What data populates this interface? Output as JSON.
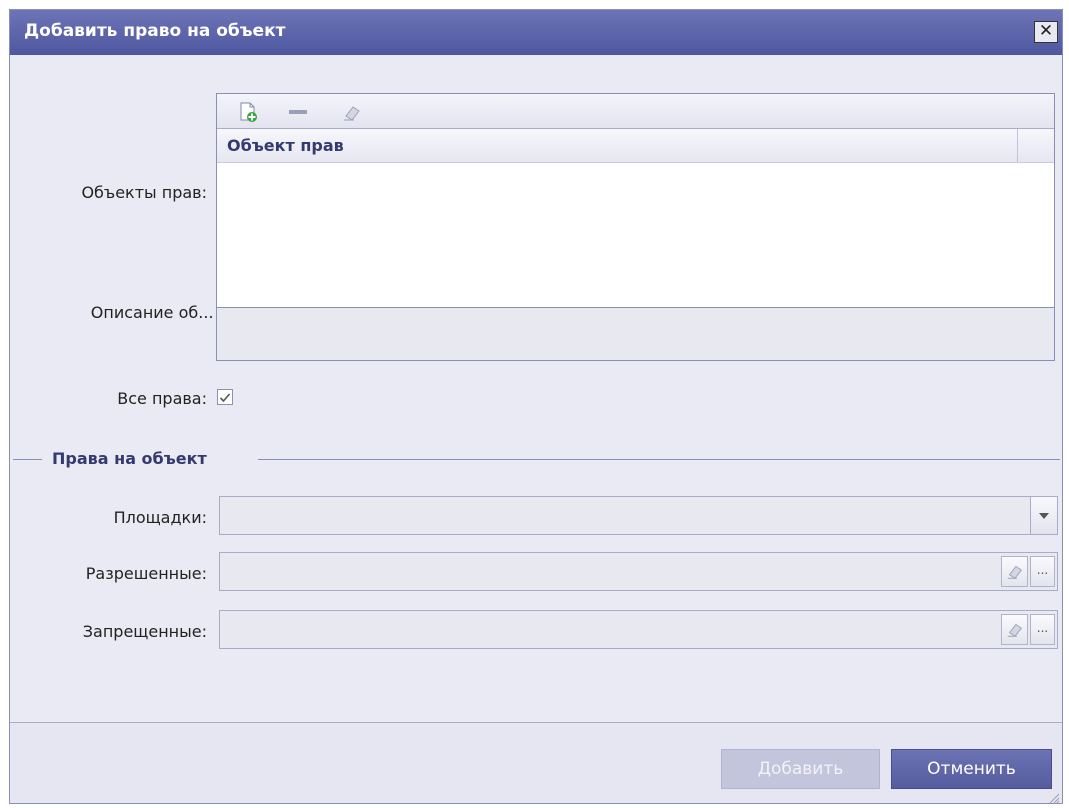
{
  "dialog": {
    "title": "Добавить право на объект",
    "close_label": "✕"
  },
  "form": {
    "objects_label": "Объекты прав:",
    "description_label": "Описание об... :",
    "all_rights_label": "Все права:",
    "all_rights_checked": true
  },
  "grid": {
    "toolbar": [
      {
        "name": "add-row-icon"
      },
      {
        "name": "remove-row-icon"
      },
      {
        "name": "clear-eraser-icon"
      }
    ],
    "columns": [
      "Объект прав"
    ],
    "rows": []
  },
  "fieldset": {
    "legend": "Права на объект",
    "sites_label": "Площадки:",
    "allowed_label": "Разрешенные:",
    "denied_label": "Запрещенные:",
    "ellipsis_label": "..."
  },
  "footer": {
    "add_label": "Добавить",
    "cancel_label": "Отменить"
  }
}
